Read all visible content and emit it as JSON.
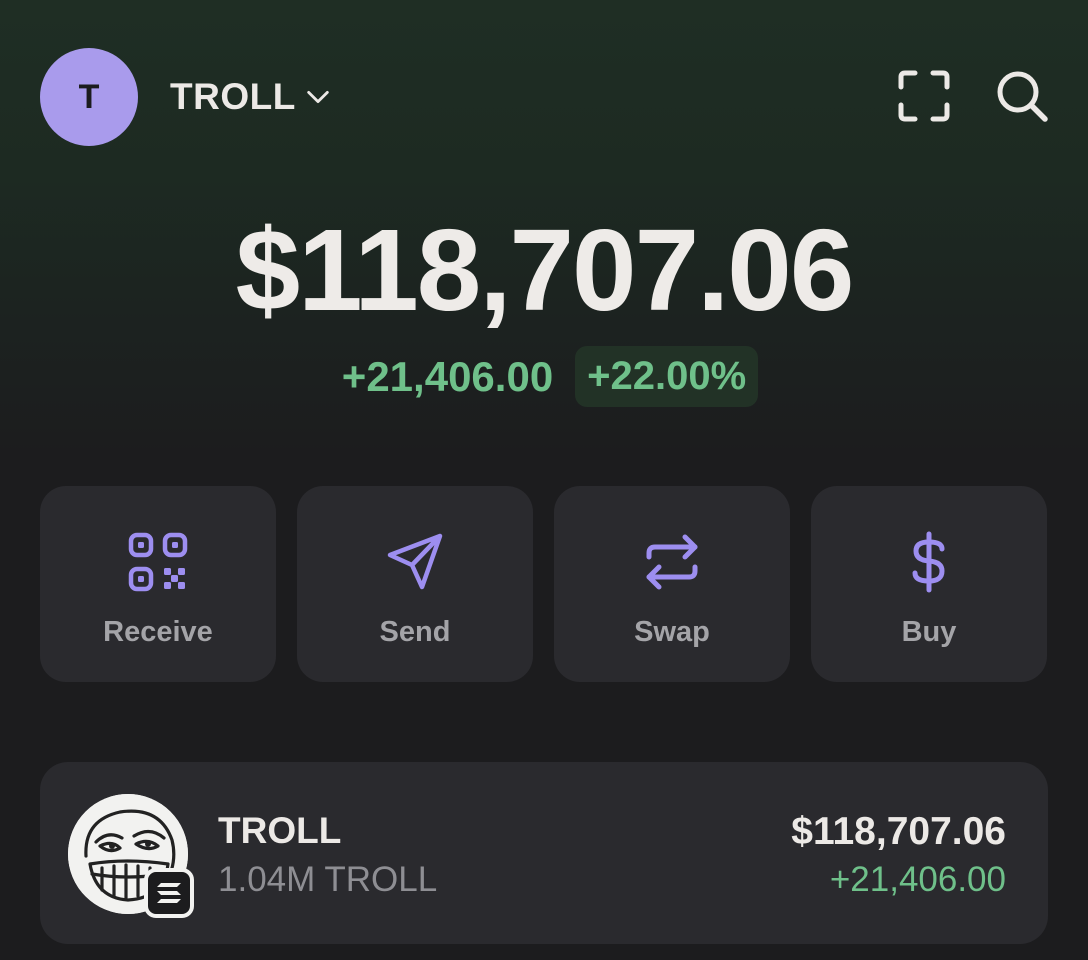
{
  "header": {
    "avatar_letter": "T",
    "account_name": "TROLL"
  },
  "balance": {
    "total": "$118,707.06",
    "change_abs": "+21,406.00",
    "change_pct": "+22.00%"
  },
  "actions": [
    {
      "label": "Receive",
      "icon": "qr-code-icon"
    },
    {
      "label": "Send",
      "icon": "send-icon"
    },
    {
      "label": "Swap",
      "icon": "swap-icon"
    },
    {
      "label": "Buy",
      "icon": "dollar-icon"
    }
  ],
  "tokens": [
    {
      "name": "TROLL",
      "quantity": "1.04M TROLL",
      "value": "$118,707.06",
      "change": "+21,406.00",
      "logo": "trollface-logo",
      "chain_badge": "solana-icon"
    }
  ],
  "colors": {
    "accent": "#a99bec",
    "positive": "#6fc08a",
    "card": "#2a2a2e",
    "background": "#1c1c1e"
  }
}
